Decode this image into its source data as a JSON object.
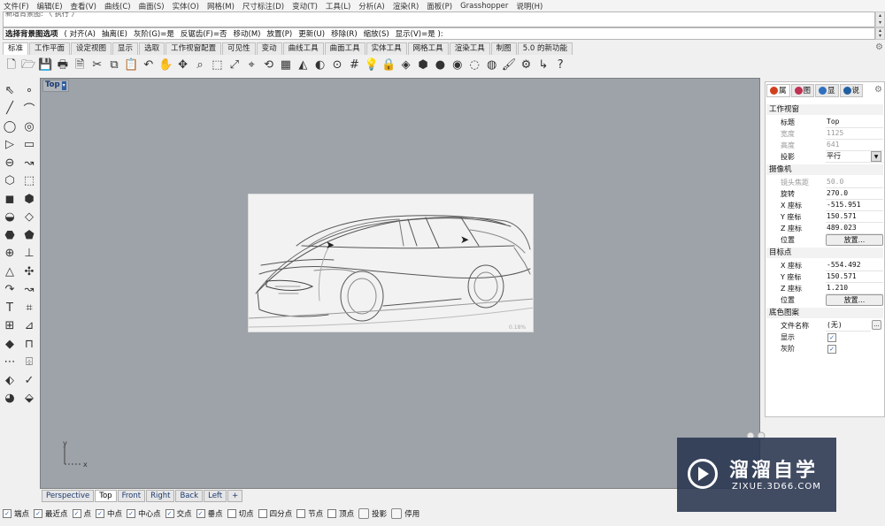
{
  "menu": [
    "文件(F)",
    "编辑(E)",
    "查看(V)",
    "曲线(C)",
    "曲面(S)",
    "实体(O)",
    "网格(M)",
    "尺寸标注(D)",
    "变动(T)",
    "工具(L)",
    "分析(A)",
    "渲染(R)",
    "面板(P)",
    "Grasshopper",
    "说明(H)"
  ],
  "command": {
    "history_text": "新增背景图: 〈 执行 〉",
    "prompt": "选择背景图选项",
    "options": [
      "( 对齐(A)",
      "抽离(E)",
      "灰阶(G)=是",
      "反锯齿(F)=否",
      "移动(M)",
      "放置(P)",
      "更新(U)",
      "移除(R)",
      "缩放(S)",
      "显示(V)=是 ):"
    ]
  },
  "tabs": [
    "标准",
    "工作平面",
    "设定视图",
    "显示",
    "选取",
    "工作视窗配置",
    "可见性",
    "变动",
    "曲线工具",
    "曲面工具",
    "实体工具",
    "网格工具",
    "渲染工具",
    "制图",
    "5.0 的新功能"
  ],
  "active_tab": "标准",
  "toolbar_icons": [
    "new-file-icon",
    "open-folder-icon",
    "save-icon",
    "print-icon",
    "import-icon",
    "cut-icon",
    "copy-icon",
    "paste-icon",
    "undo-icon",
    "pan-hand-icon",
    "move-view-icon",
    "zoom-icon",
    "zoom-window-icon",
    "zoom-extents-icon",
    "zoom-selected-icon",
    "rotate-view-icon",
    "four-views-icon",
    "cplane-icon",
    "hide-icon",
    "snap-icon",
    "grid-icon",
    "light-bulb-icon",
    "lock-icon",
    "layer-icon",
    "material-icon",
    "render-sphere-icon",
    "shaded-sphere-icon",
    "ghosted-sphere-icon",
    "rendered-sphere-icon",
    "paint-icon",
    "settings-icon",
    "dimension-icon",
    "help-icon"
  ],
  "toolbar_glyphs": [
    "🗋",
    "🗁",
    "💾",
    "🖶",
    "🗎",
    "✂",
    "⧉",
    "📋",
    "↶",
    "✋",
    "✥",
    "⌕",
    "⬚",
    "⤢",
    "⌖",
    "⟲",
    "▦",
    "◭",
    "◐",
    "⊙",
    "#",
    "💡",
    "🔒",
    "◈",
    "⬢",
    "●",
    "◉",
    "◌",
    "◍",
    "🖌",
    "⚙",
    "↳",
    "?"
  ],
  "left_tools": [
    "⇖",
    "∘",
    "╱",
    "⌒",
    "◯",
    "◎",
    "▷",
    "▭",
    "⊖",
    "↝",
    "⬡",
    "⬚",
    "◼",
    "⬢",
    "◒",
    "◇",
    "⬣",
    "⬟",
    "⊕",
    "⊥",
    "△",
    "✣",
    "↷",
    "↝",
    "T",
    "⌗",
    "⊞",
    "⊿",
    "◆",
    "⊓",
    "⋯",
    "⌹",
    "⬖",
    "✓",
    "◕",
    "⬙"
  ],
  "viewport": {
    "title": "Top",
    "title_arrow": "▾"
  },
  "viewport_tabs": [
    "Perspective",
    "Top",
    "Front",
    "Right",
    "Back",
    "Left"
  ],
  "active_viewport_tab": "Top",
  "add_tab": "+",
  "axes": {
    "x": "x",
    "y": "y"
  },
  "sketch": {
    "corner_text": "0.18%"
  },
  "panel": {
    "tabs": [
      "属",
      "图",
      "显",
      "说"
    ],
    "sections": {
      "viewport": "工作视窗",
      "camera": "摄像机",
      "target": "目标点",
      "wallpaper": "底色图案"
    },
    "rows": {
      "title": {
        "label": "标题",
        "value": "Top"
      },
      "width": {
        "label": "宽度",
        "value": "1125"
      },
      "height": {
        "label": "高度",
        "value": "641"
      },
      "projection": {
        "label": "投影",
        "value": "平行"
      },
      "lens": {
        "label": "镜头焦距",
        "value": "50.0"
      },
      "rotation": {
        "label": "旋转",
        "value": "270.0"
      },
      "cam_x": {
        "label": "X 座标",
        "value": "-515.951"
      },
      "cam_y": {
        "label": "Y 座标",
        "value": "150.571"
      },
      "cam_z": {
        "label": "Z 座标",
        "value": "489.023"
      },
      "cam_pos": {
        "label": "位置",
        "button": "放置..."
      },
      "tgt_x": {
        "label": "X 座标",
        "value": "-554.492"
      },
      "tgt_y": {
        "label": "Y 座标",
        "value": "150.571"
      },
      "tgt_z": {
        "label": "Z 座标",
        "value": "1.210"
      },
      "tgt_pos": {
        "label": "位置",
        "button": "放置..."
      },
      "filename": {
        "label": "文件名称",
        "value": "(无)",
        "button": "..."
      },
      "show": {
        "label": "显示",
        "checked": true
      },
      "gray": {
        "label": "灰阶",
        "checked": true
      }
    }
  },
  "osnaps": [
    {
      "label": "端点",
      "checked": true
    },
    {
      "label": "最近点",
      "checked": true
    },
    {
      "label": "点",
      "checked": true
    },
    {
      "label": "中点",
      "checked": true
    },
    {
      "label": "中心点",
      "checked": true
    },
    {
      "label": "交点",
      "checked": true
    },
    {
      "label": "垂点",
      "checked": true
    },
    {
      "label": "切点",
      "checked": false
    },
    {
      "label": "四分点",
      "checked": false
    },
    {
      "label": "节点",
      "checked": false
    },
    {
      "label": "顶点",
      "checked": false
    }
  ],
  "toggles": [
    "投影",
    "停用"
  ],
  "checkmark": "✓",
  "watermark": {
    "title": "溜溜自学",
    "url": "ZIXUE.3D66.COM"
  },
  "colors": {
    "viewport_bg": "#9ea3a9",
    "active_title": "#1c3a70",
    "watermark_bg": "#28344e"
  }
}
